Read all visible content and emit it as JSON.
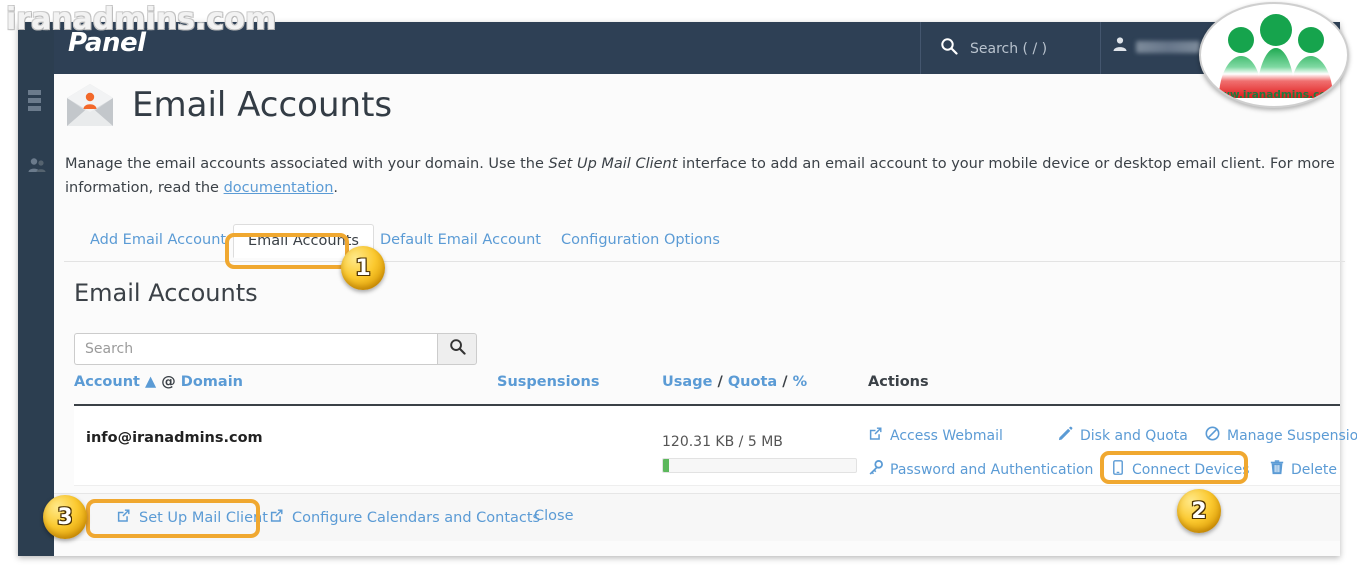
{
  "watermark": {
    "text": "iranadmins.com",
    "logo_caption": "www.iranadmins.com"
  },
  "topbar": {
    "brand": "Panel",
    "search_label": "Search ( / )",
    "search_icon": "search-icon",
    "user_icon": "user-icon",
    "caret_icon": "chevron-down-icon"
  },
  "page": {
    "title": "Email Accounts",
    "title_icon": "email-account-icon",
    "description_part1": "Manage the email accounts associated with your domain. Use the ",
    "description_emphasis": "Set Up Mail Client",
    "description_part2": " interface to add an email account to your mobile device or desktop email client. For more information, read the ",
    "description_link": "documentation",
    "description_end": "."
  },
  "tabs": [
    {
      "label": "Add Email Account",
      "active": false
    },
    {
      "label": "Email Accounts",
      "active": true
    },
    {
      "label": "Default Email Account",
      "active": false
    },
    {
      "label": "Configuration Options",
      "active": false
    }
  ],
  "section": {
    "heading": "Email Accounts"
  },
  "search": {
    "value": "",
    "placeholder": "Search",
    "button_icon": "search-icon"
  },
  "table": {
    "headers": {
      "account": "Account",
      "account_sort": "▲",
      "account_at": "@",
      "account_domain": "Domain",
      "suspensions": "Suspensions",
      "usage": "Usage",
      "quota": "Quota",
      "percent": "%",
      "slash": "/",
      "actions": "Actions"
    },
    "rows": [
      {
        "account": "info@iranadmins.com",
        "suspensions": "",
        "usage_text": "120.31 KB / 5 MB",
        "usage_percent": 3,
        "actions": [
          {
            "label": "Access Webmail",
            "icon": "external-link-icon"
          },
          {
            "label": "Disk and Quota",
            "icon": "pencil-icon"
          },
          {
            "label": "Manage Suspension",
            "icon": "ban-icon"
          },
          {
            "label": "Password and Authentication",
            "icon": "key-icon"
          },
          {
            "label": "Connect Devices",
            "icon": "mobile-icon"
          },
          {
            "label": "Delete",
            "icon": "trash-icon"
          }
        ]
      }
    ]
  },
  "footer": {
    "links": [
      {
        "label": "Set Up Mail Client",
        "icon": "external-link-icon"
      },
      {
        "label": "Configure Calendars and Contacts",
        "icon": "external-link-icon"
      },
      {
        "label": "Close",
        "icon": ""
      }
    ]
  },
  "annotations": {
    "badges": [
      "1",
      "2",
      "3"
    ],
    "highlight_color": "#f0a830"
  }
}
